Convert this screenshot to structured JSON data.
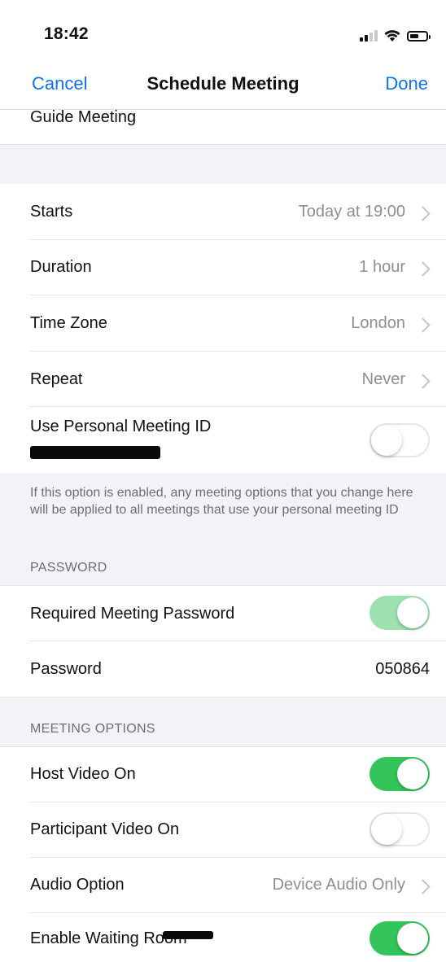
{
  "status_bar": {
    "time": "18:42"
  },
  "nav": {
    "cancel": "Cancel",
    "title": "Schedule Meeting",
    "done": "Done"
  },
  "topic": {
    "value": "Guide Meeting"
  },
  "schedule": {
    "starts": {
      "label": "Starts",
      "value": "Today at 19:00"
    },
    "duration": {
      "label": "Duration",
      "value": "1 hour"
    },
    "time_zone": {
      "label": "Time Zone",
      "value": "London"
    },
    "repeat": {
      "label": "Repeat",
      "value": "Never"
    },
    "personal_meeting_id": {
      "label": "Use Personal Meeting ID",
      "enabled": false
    },
    "pmi_note": "If this option is enabled, any meeting options that you change here will be applied to all meetings that use your personal meeting ID"
  },
  "password_section": {
    "header": "PASSWORD",
    "required": {
      "label": "Required Meeting Password",
      "enabled": true
    },
    "password": {
      "label": "Password",
      "value": "050864"
    }
  },
  "meeting_options": {
    "header": "MEETING OPTIONS",
    "host_video": {
      "label": "Host Video On",
      "enabled": true
    },
    "participant_video": {
      "label": "Participant Video On",
      "enabled": false
    },
    "audio_option": {
      "label": "Audio Option",
      "value": "Device Audio Only"
    },
    "waiting_room": {
      "label": "Enable Waiting Room",
      "enabled": true
    }
  },
  "colors": {
    "accent": "#0e72ed",
    "toggle_on": "#33c45a",
    "toggle_on_disabled": "#9ee1b0",
    "grouped_background": "#f2f2f7",
    "secondary_text": "#8e8e93"
  },
  "icons": [
    "cellular-signal-icon",
    "wifi-icon",
    "battery-icon",
    "chevron-right-icon"
  ]
}
